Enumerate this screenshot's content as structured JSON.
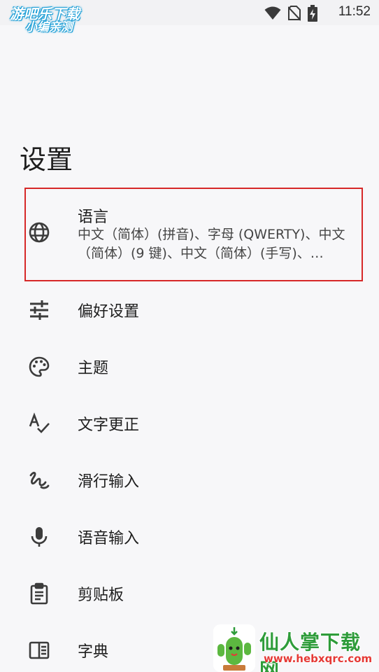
{
  "status_bar": {
    "time": "11:52",
    "icons": [
      "notification-icon",
      "wifi-icon",
      "no-sim-icon",
      "battery-charging-icon"
    ]
  },
  "watermark_top": {
    "line1": "游吧乐下载",
    "line2": "小编亲测"
  },
  "page": {
    "title": "设置"
  },
  "settings": [
    {
      "icon": "globe-icon",
      "label": "语言",
      "summary": "中文（简体）(拼音)、字母 (QWERTY)、中文（简体）(9 键)、中文（简体）(手写)、…",
      "highlighted": true
    },
    {
      "icon": "sliders-icon",
      "label": "偏好设置"
    },
    {
      "icon": "palette-icon",
      "label": "主题"
    },
    {
      "icon": "spellcheck-icon",
      "label": "文字更正"
    },
    {
      "icon": "gesture-icon",
      "label": "滑行输入"
    },
    {
      "icon": "mic-icon",
      "label": "语音输入"
    },
    {
      "icon": "clipboard-icon",
      "label": "剪贴板"
    },
    {
      "icon": "dictionary-icon",
      "label": "字典"
    }
  ],
  "watermark_bottom": {
    "brand": "仙人掌下载网",
    "url": "www.hebxqrc.com"
  },
  "colors": {
    "background": "#f7f7f9",
    "highlight_border": "#d62828",
    "icon": "#3c3c3c",
    "brand_green": "#2e9c3a",
    "brand_red": "#e53935"
  }
}
